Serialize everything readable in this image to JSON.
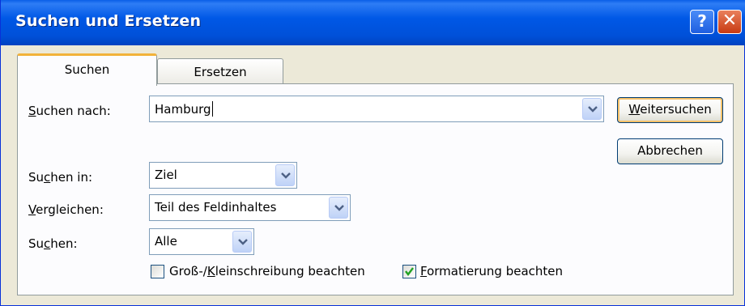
{
  "window": {
    "title": "Suchen und Ersetzen",
    "help_label": "?",
    "close_label": "✕"
  },
  "tabs": [
    {
      "label": "Suchen",
      "active": true
    },
    {
      "label": "Ersetzen",
      "active": false
    }
  ],
  "fields": {
    "suchen_nach": {
      "label_pre": "",
      "label_accel": "S",
      "label_post": "uchen nach:",
      "value": "Hamburg"
    },
    "suchen_in": {
      "label_pre": "Su",
      "label_accel": "c",
      "label_post": "hen in:",
      "value": "Ziel"
    },
    "vergleichen": {
      "label_pre": "",
      "label_accel": "V",
      "label_post": "ergleichen:",
      "value": "Teil des Feldinhaltes"
    },
    "suchen": {
      "label_pre": "Su",
      "label_accel": "c",
      "label_post": "hen:",
      "value": "Alle"
    }
  },
  "buttons": {
    "weitersuchen": {
      "accel": "W",
      "rest": "eitersuchen"
    },
    "abbrechen": {
      "label": "Abbrechen"
    }
  },
  "checkboxes": {
    "gross_klein": {
      "pre": "Groß-/",
      "accel": "K",
      "post": "leinschreibung beachten",
      "checked": false
    },
    "formatierung": {
      "pre": "",
      "accel": "F",
      "post": "ormatierung beachten",
      "checked": true
    }
  },
  "colors": {
    "titlebar": "#0058e6",
    "tab_highlight": "#f2b23a",
    "dialog_bg": "#ece9d8",
    "check_color": "#21a121"
  }
}
